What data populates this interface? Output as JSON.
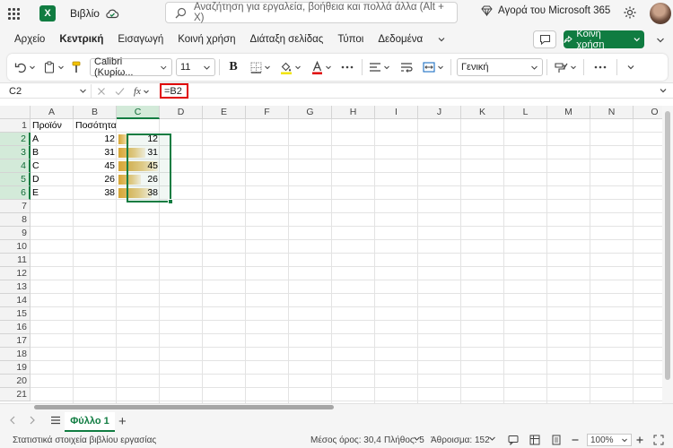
{
  "app": {
    "name": "Excel",
    "logo_letter": "X",
    "doc_title": "Βιβλίο"
  },
  "search": {
    "placeholder": "Αναζήτηση για εργαλεία, βοήθεια και πολλά άλλα (Alt + X)"
  },
  "header": {
    "buy_label": "Αγορά του Microsoft 365"
  },
  "ribbon": {
    "tabs": [
      "Αρχείο",
      "Κεντρική",
      "Εισαγωγή",
      "Κοινή χρήση",
      "Διάταξη σελίδας",
      "Τύποι",
      "Δεδομένα"
    ],
    "active_tab": "Κεντρική",
    "share_label": "Κοινή χρήση"
  },
  "toolbar": {
    "font_name": "Calibri (Κυρίω...",
    "font_size": "11",
    "number_format": "Γενική"
  },
  "formula_bar": {
    "name_box": "C2",
    "fx_label": "fx",
    "formula": "=B2"
  },
  "grid": {
    "columns": [
      "A",
      "B",
      "C",
      "D",
      "E",
      "F",
      "G",
      "H",
      "I",
      "J",
      "K",
      "L",
      "M",
      "N",
      "O"
    ],
    "selected_column": "C",
    "rows": [
      "1",
      "2",
      "3",
      "4",
      "5",
      "6",
      "7",
      "8",
      "9",
      "10",
      "11",
      "12",
      "13",
      "14",
      "15",
      "16",
      "17",
      "18",
      "19",
      "20",
      "21"
    ],
    "selected_rows": [
      "2",
      "3",
      "4",
      "5",
      "6"
    ],
    "header_row": {
      "a": "Προϊόν",
      "b": "Ποσότητα"
    },
    "data": [
      {
        "product": "A",
        "qty": "12",
        "ref": "12",
        "bar": 0.267
      },
      {
        "product": "B",
        "qty": "31",
        "ref": "31",
        "bar": 0.689
      },
      {
        "product": "C",
        "qty": "45",
        "ref": "45",
        "bar": 1.0
      },
      {
        "product": "D",
        "qty": "26",
        "ref": "26",
        "bar": 0.578
      },
      {
        "product": "E",
        "qty": "38",
        "ref": "38",
        "bar": 0.844
      }
    ]
  },
  "sheets": {
    "active": "Φύλλο 1"
  },
  "status": {
    "left": "Στατιστικά στοιχεία βιβλίου εργασίας",
    "average": "Μέσος όρος: 30,4",
    "count": "Πλήθος: 5",
    "sum": "Άθροισμα: 152",
    "zoom": "100%"
  },
  "colors": {
    "accent": "#107c41",
    "databar": "#d6a534",
    "highlight": "#e00000"
  }
}
